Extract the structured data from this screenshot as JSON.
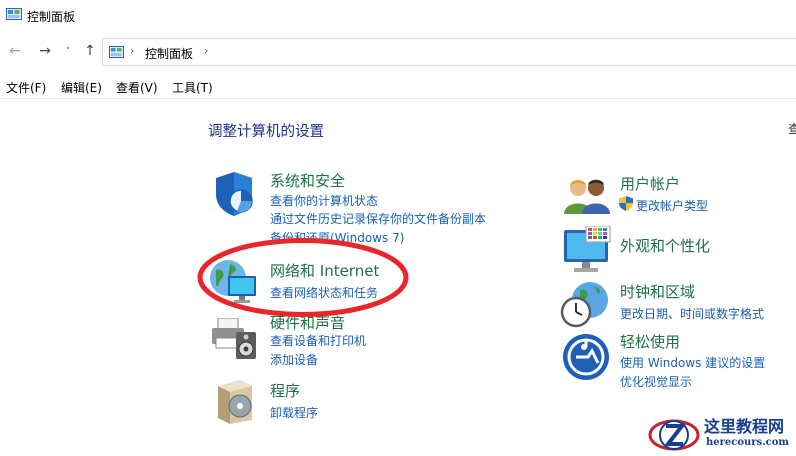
{
  "window": {
    "title": "控制面板"
  },
  "nav": {
    "back_icon": "←",
    "forward_icon": "→",
    "recent_icon": "˅",
    "up_icon": "↑"
  },
  "address": {
    "chevron": "›",
    "crumb": "控制面板"
  },
  "menu": {
    "items": [
      "文件(F)",
      "编辑(E)",
      "查看(V)",
      "工具(T)"
    ]
  },
  "main": {
    "heading": "调整计算机的设置",
    "view_by_partial": "查"
  },
  "categories": {
    "system_security": {
      "title": "系统和安全",
      "links": [
        "查看你的计算机状态",
        "通过文件历史记录保存你的文件备份副本",
        "备份和还原(Windows 7)"
      ]
    },
    "network": {
      "title": "网络和 Internet",
      "links": [
        "查看网络状态和任务"
      ]
    },
    "hardware_sound": {
      "title": "硬件和声音",
      "links": [
        "查看设备和打印机",
        "添加设备"
      ]
    },
    "programs": {
      "title": "程序",
      "links": [
        "卸载程序"
      ]
    },
    "user_accounts": {
      "title": "用户帐户",
      "links": [
        "更改帐户类型"
      ]
    },
    "appearance": {
      "title": "外观和个性化"
    },
    "clock_region": {
      "title": "时钟和区域",
      "links": [
        "更改日期、时间或数字格式"
      ]
    },
    "ease_access": {
      "title": "轻松使用",
      "links": [
        "使用 Windows 建议的设置",
        "优化视觉显示"
      ]
    }
  },
  "watermark": {
    "title": "这里教程网",
    "url": "herecours.com"
  },
  "colors": {
    "category_title": "#1e7145",
    "link": "#1a5faf",
    "heading": "#1e3287",
    "annotation_ellipse": "#e8262b"
  }
}
